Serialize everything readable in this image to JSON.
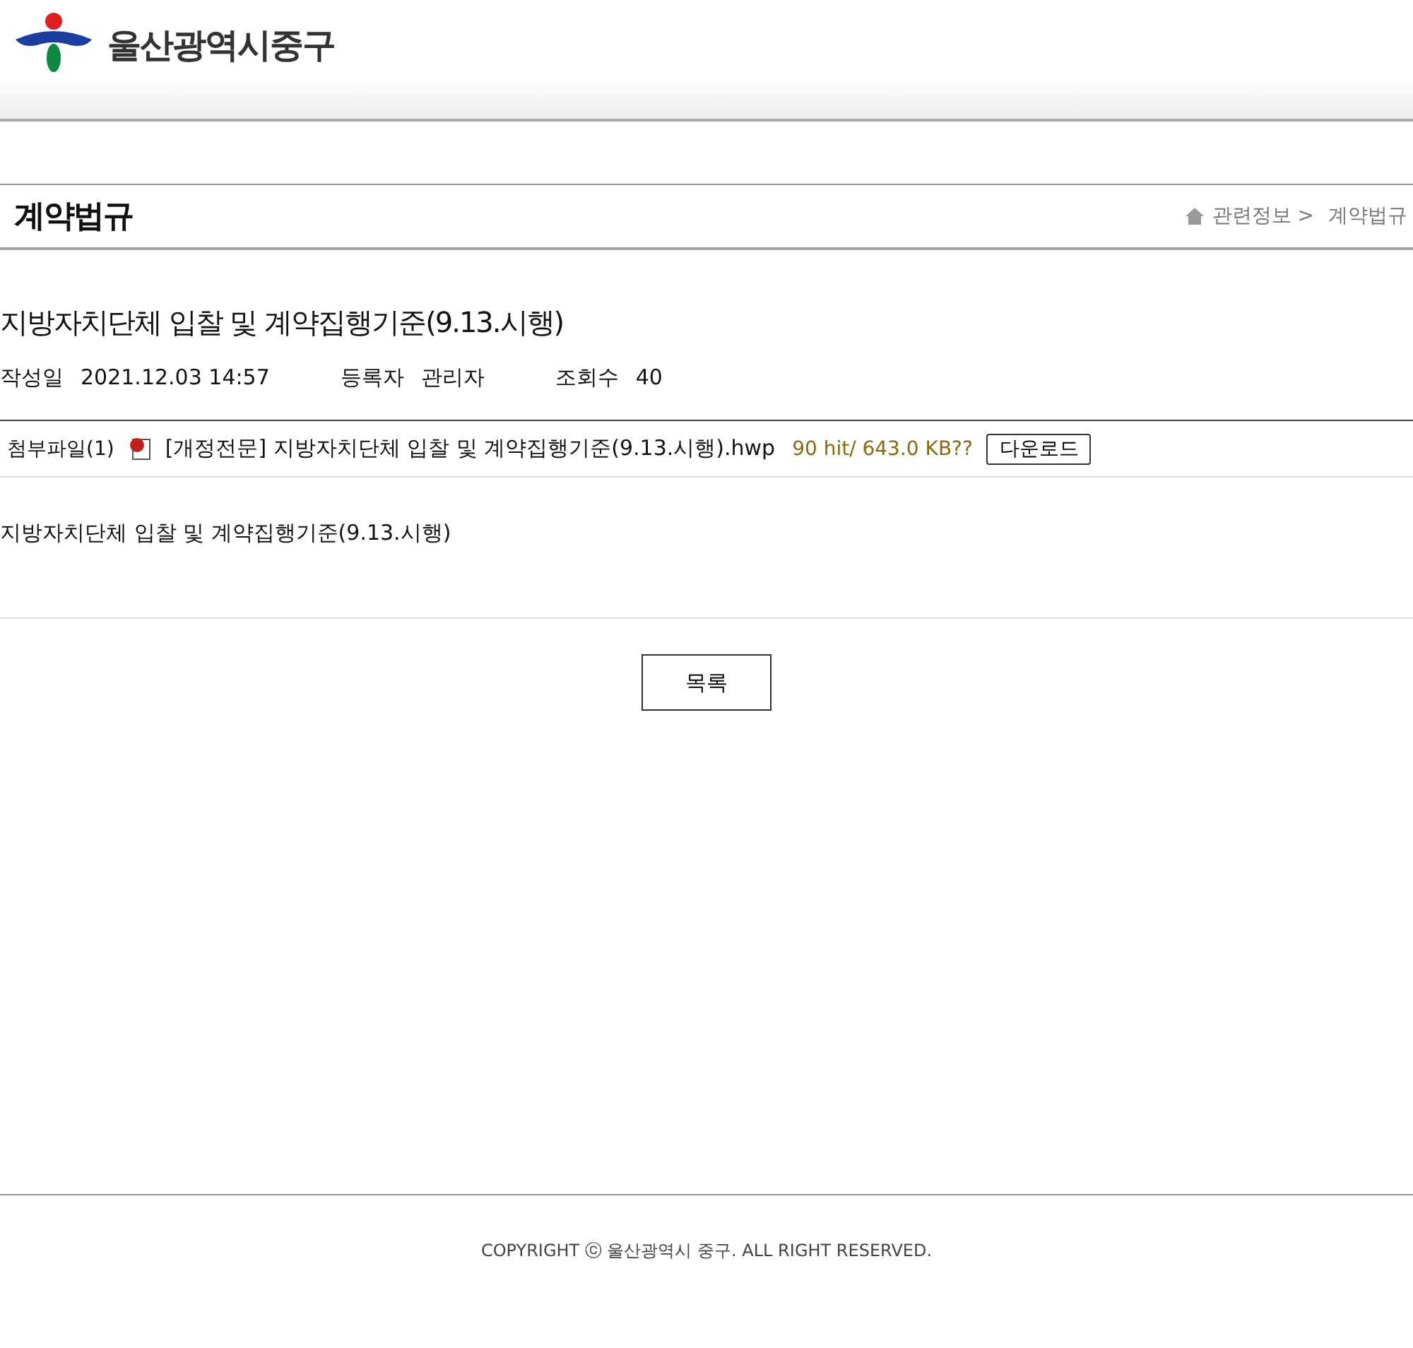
{
  "header": {
    "logo_text": "울산광역시중구"
  },
  "page": {
    "title": "계약법규",
    "breadcrumb": [
      {
        "label": "관련정보 >"
      },
      {
        "label": "계약법규"
      }
    ]
  },
  "post": {
    "title": "지방자치단체 입찰 및 계약집행기준(9.13.시행)",
    "meta": [
      {
        "label": "작성일",
        "value": "2021.12.03 14:57"
      },
      {
        "label": "등록자",
        "value": "관리자"
      },
      {
        "label": "조회수",
        "value": "40"
      }
    ],
    "attachment": {
      "label": "첨부파일(1)",
      "file_name": "[개정전문] 지방자치단체 입찰 및 계약집행기준(9.13.시행).hwp",
      "info": "90 hit/ 643.0 KB??",
      "button": "다운로드"
    },
    "body": "지방자치단체 입찰 및 계약집행기준(9.13.시행)",
    "list_button": "목록"
  },
  "footer": {
    "copyright": "COPYRIGHT ⓒ 울산광역시 중구. ALL RIGHT RESERVED."
  }
}
